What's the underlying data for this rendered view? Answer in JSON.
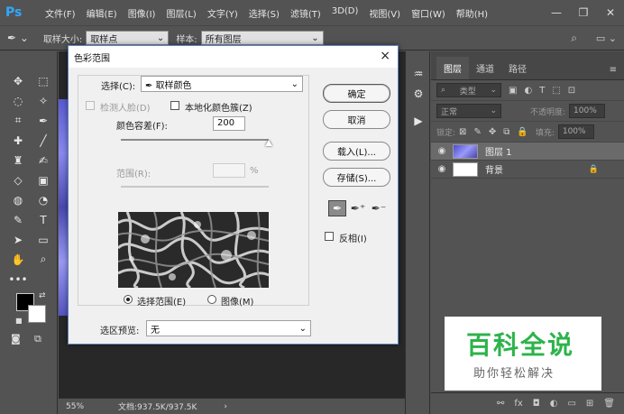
{
  "app": {
    "logo": "Ps"
  },
  "menu": [
    "文件(F)",
    "编辑(E)",
    "图像(I)",
    "图层(L)",
    "文字(Y)",
    "选择(S)",
    "滤镜(T)",
    "3D(D)",
    "视图(V)",
    "窗口(W)",
    "帮助(H)"
  ],
  "window_controls": {
    "minimize": "—",
    "restore": "❐",
    "close": "✕"
  },
  "options": {
    "sample_size_label": "取样大小:",
    "sample_size_value": "取样点",
    "sample_label": "样本:",
    "sample_value": "所有图层"
  },
  "dialog": {
    "title": "色彩范围",
    "close": "×",
    "select_label": "选择(C):",
    "select_value": "取样颜色",
    "detect_faces_label": "检测人脸(D)",
    "localized_label": "本地化颜色簇(Z)",
    "fuzziness_label": "颜色容差(F):",
    "fuzziness_value": "200",
    "range_label": "范围(R):",
    "range_unit": "%",
    "radio_selection": "选择范围(E)",
    "radio_image": "图像(M)",
    "preview_label": "选区预览:",
    "preview_value": "无",
    "btn_ok": "确定",
    "btn_cancel": "取消",
    "btn_load": "载入(L)...",
    "btn_save": "存储(S)...",
    "invert_label": "反相(I)",
    "fuzziness_fraction": 1.0
  },
  "status": {
    "zoom": "55%",
    "doc": "文档:937.5K/937.5K",
    "arrow": "›"
  },
  "layers_panel": {
    "tabs": [
      "图层",
      "通道",
      "路径"
    ],
    "kind_label": "类型",
    "blend_mode": "正常",
    "opacity_label": "不透明度:",
    "opacity_value": "100%",
    "lock_label": "锁定:",
    "fill_label": "填充:",
    "fill_value": "100%",
    "layers": [
      {
        "name": "图层 1"
      },
      {
        "name": "背景"
      }
    ]
  },
  "watermark": {
    "title": "百科全说",
    "subtitle": "助你轻松解决"
  }
}
